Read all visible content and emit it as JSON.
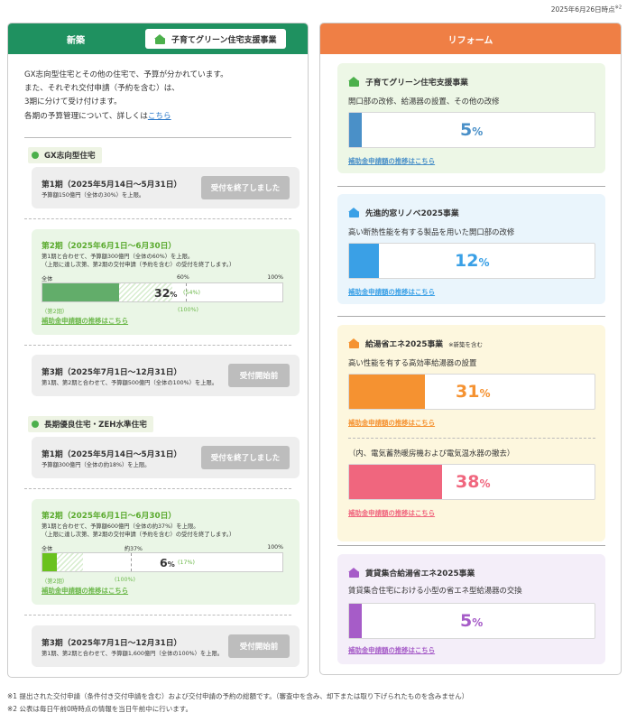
{
  "as_of": "2025年6月26日時点",
  "as_of_note": "※2",
  "left": {
    "title": "新築",
    "tab": "子育てグリーン住宅支援事業",
    "intro": [
      "GX志向型住宅とその他の住宅で、予算が分かれています。",
      "また、それぞれ交付申請（予約を含む）は、",
      "3期に分けて受け付けます。"
    ],
    "intro_last": "各期の予算管理について、詳しくは",
    "intro_link": "こちら",
    "cat1": "GX志向型住宅",
    "cat2": "長期優良住宅・ZEH水準住宅",
    "gx": {
      "p1": {
        "title": "第1期（2025年5月14日～5月31日）",
        "sub": "予算額150億円（全体の30%）を上限。",
        "btn": "受付を終了しました"
      },
      "p2": {
        "title": "第2期（2025年6月1日～6月30日）",
        "sub1": "第1期と合わせて、予算額300億円（全体の60%）を上限。",
        "sub2": "（上限に達し次第、第2期の交付申請（予約を含む）の受付を終了します。）",
        "s_all": "全体",
        "s_mid": "60%",
        "s_max": "100%",
        "value": "32",
        "unit": "%",
        "limit": "(54%)",
        "lbl_period": "（第2期）",
        "lbl_total": "(100%)",
        "link": "補助金申請額の推移はこちら",
        "progress": 0.32,
        "limit_fraction": 0.54,
        "period_fraction": 0.6
      },
      "p3": {
        "title": "第3期（2025年7月1日～12月31日）",
        "sub": "第1期、第2期と合わせて、予算額500億円（全体の100%）を上限。",
        "btn": "受付開始前"
      }
    },
    "lq": {
      "p1": {
        "title": "第1期（2025年5月14日～5月31日）",
        "sub": "予算額300億円（全体の約18%）を上限。",
        "btn": "受付を終了しました"
      },
      "p2": {
        "title": "第2期（2025年6月1日～6月30日）",
        "sub1": "第1期と合わせて、予算額600億円（全体の約37%）を上限。",
        "sub2": "（上限に達し次第、第2期の交付申請（予約を含む）の受付を終了します。）",
        "s_all": "全体",
        "s_mid": "約37%",
        "s_max": "100%",
        "value": "6",
        "unit": "%",
        "limit": "(17%)",
        "lbl_period": "（第2期）",
        "lbl_total": "(100%)",
        "link": "補助金申請額の推移はこちら",
        "progress": 0.06,
        "limit_fraction": 0.17,
        "period_fraction": 0.37
      },
      "p3": {
        "title": "第3期（2025年7月1日～12月31日）",
        "sub": "第1期、第2期と合わせて、予算額1,600億円（全体の100%）を上限。",
        "btn": "受付開始前"
      }
    }
  },
  "right": {
    "title": "リフォーム",
    "items": [
      {
        "title": "子育てグリーン住宅支援事業",
        "note": "",
        "desc": "開口部の改修、給湯器の設置、その他の改修",
        "value": "5",
        "unit": "%",
        "progress": 0.05,
        "link": "補助金申請額の推移はこちら",
        "color": "#4a90c8",
        "icon_color": "#4cb04c",
        "bg": "#edf7e6"
      },
      {
        "title": "先進的窓リノベ2025事業",
        "note": "",
        "desc": "高い断熱性能を有する製品を用いた開口部の改修",
        "value": "12",
        "unit": "%",
        "progress": 0.12,
        "link": "補助金申請額の推移はこちら",
        "color": "#3aa0e6",
        "icon_color": "#3aa0e6",
        "bg": "#eaf5fc"
      },
      {
        "title": "給湯省エネ2025事業",
        "note": "※新築を含む",
        "desc": "高い性能を有する高効率給湯器の設置",
        "value": "31",
        "unit": "%",
        "progress": 0.31,
        "link": "補助金申請額の推移はこちら",
        "color": "#f59231",
        "icon_color": "#f59231",
        "bg": "#fdf7de"
      },
      {
        "title": "",
        "note": "",
        "desc": "（内、電気蓄熱暖房機および電気温水器の撤去）",
        "value": "38",
        "unit": "%",
        "progress": 0.38,
        "link": "補助金申請額の推移はこちら",
        "color": "#f0667e",
        "icon_color": "",
        "bg": "#fdf7de"
      },
      {
        "title": "賃貸集合給湯省エネ2025事業",
        "note": "",
        "desc": "賃貸集合住宅における小型の省エネ型給湯器の交換",
        "value": "5",
        "unit": "%",
        "progress": 0.05,
        "link": "補助金申請額の推移はこちら",
        "color": "#a65cc8",
        "icon_color": "#a65cc8",
        "bg": "#f4eef9"
      }
    ]
  },
  "footnotes": [
    "※1 提出された交付申請（条件付き交付申請を含む）および交付申請の予約の総額です。（審査中を含み、却下または取り下げられたものを含みません）",
    "※2 公表は毎日午前0時時点の情報を当日午前中に行います。"
  ]
}
